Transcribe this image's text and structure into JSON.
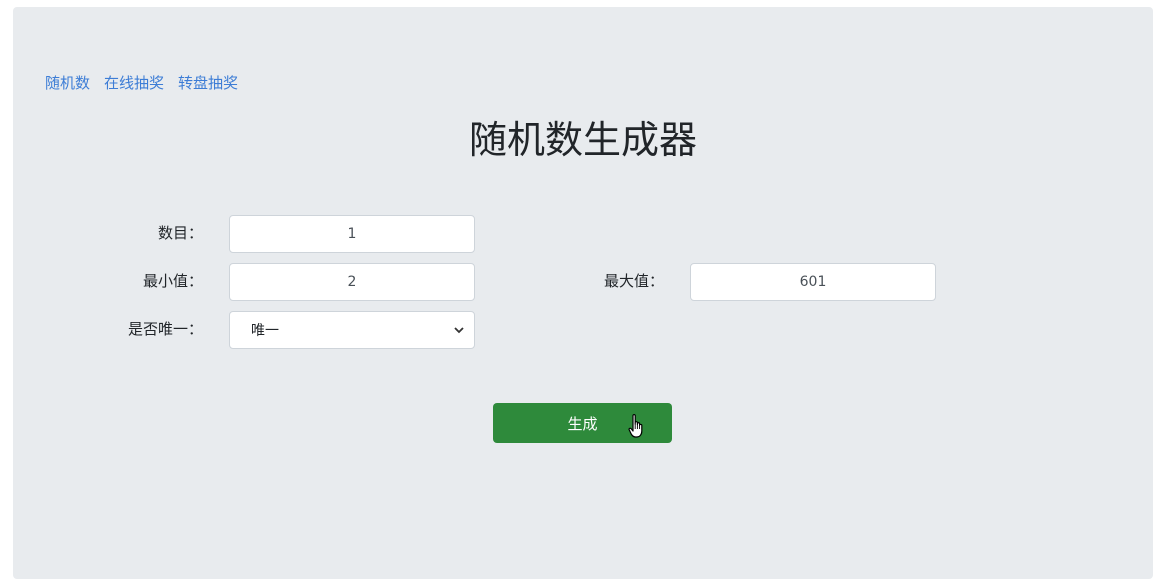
{
  "nav": {
    "links": [
      "随机数",
      "在线抽奖",
      "转盘抽奖"
    ]
  },
  "page": {
    "title": "随机数生成器"
  },
  "form": {
    "count_label": "数目：",
    "count_value": "1",
    "min_label": "最小值：",
    "min_value": "2",
    "max_label": "最大值：",
    "max_value": "601",
    "unique_label": "是否唯一：",
    "unique_selected": "唯一"
  },
  "actions": {
    "generate_label": "生成"
  },
  "colors": {
    "panel_bg": "#e8ebee",
    "link": "#3d7dd6",
    "button_bg": "#2e8a3b"
  },
  "icons": {
    "select_arrow": "chevron-down-icon",
    "pointer": "hand-pointer-icon"
  }
}
